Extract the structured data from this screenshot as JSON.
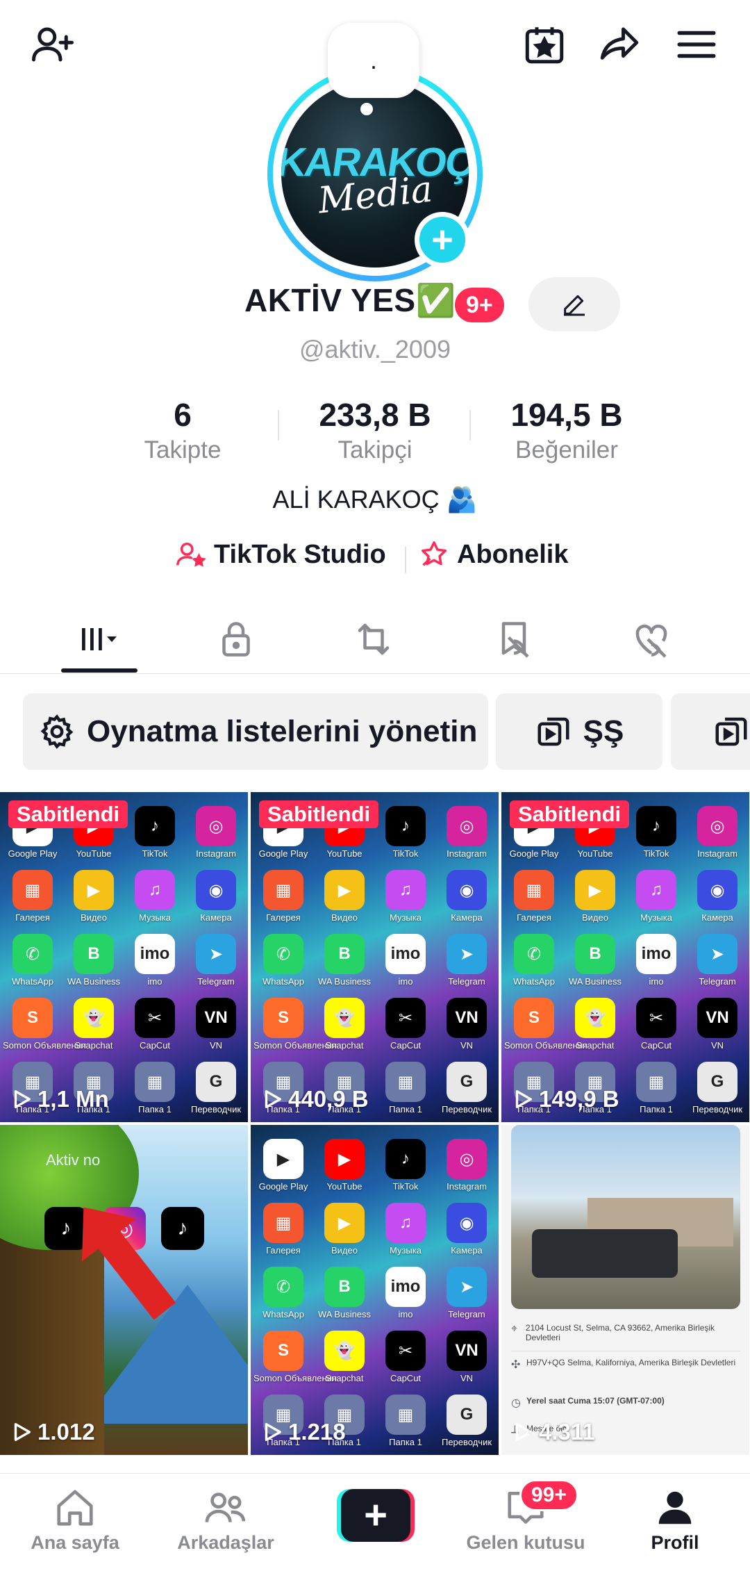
{
  "topbar": {
    "add_friend_icon": "person-plus-icon",
    "calendar_icon": "calendar-star-icon",
    "share_icon": "share-arrow-icon",
    "menu_icon": "hamburger-menu-icon"
  },
  "profile": {
    "note_text": ".",
    "avatar_logo_line1": "KARAKOÇ",
    "avatar_logo_line2": "Media",
    "display_name": "AKTİV YES✅",
    "notification_badge": "9+",
    "username": "@aktiv._2009",
    "bio": "ALİ KARAKOÇ 🫂"
  },
  "stats": [
    {
      "value": "6",
      "label": "Takipte"
    },
    {
      "value": "233,8 B",
      "label": "Takipçi"
    },
    {
      "value": "194,5 B",
      "label": "Beğeniler"
    }
  ],
  "links": {
    "studio": "TikTok Studio",
    "subscription": "Abonelik"
  },
  "tabs": [
    "videos-tab",
    "private-tab",
    "reposts-tab",
    "favorites-tab",
    "liked-tab"
  ],
  "chips": {
    "manage_playlists": "Oynatma listelerini yönetin",
    "playlist_1": "ŞŞ"
  },
  "videos": [
    {
      "pinned": "Sabitlendi",
      "views": "1,1 Mn"
    },
    {
      "pinned": "Sabitlendi",
      "views": "440,9 B"
    },
    {
      "pinned": "Sabitlendi",
      "views": "149,9 B"
    },
    {
      "views": "1.012",
      "overlay_text": "Aktiv no"
    },
    {
      "views": "1.218"
    },
    {
      "views": "4.311"
    }
  ],
  "app_grid": [
    {
      "label": "Google Play",
      "color": "#ffffff",
      "glyph": "▶"
    },
    {
      "label": "YouTube",
      "color": "#ff0000",
      "glyph": "▶"
    },
    {
      "label": "TikTok",
      "color": "#000000",
      "glyph": "♪"
    },
    {
      "label": "Instagram",
      "color": "#d6249f",
      "glyph": "◎"
    },
    {
      "label": "Галерея",
      "color": "#f4562f",
      "glyph": "▦"
    },
    {
      "label": "Видео",
      "color": "#f5c116",
      "glyph": "▶"
    },
    {
      "label": "Музыка",
      "color": "#c44cf0",
      "glyph": "♫"
    },
    {
      "label": "Камера",
      "color": "#3a4de0",
      "glyph": "◉"
    },
    {
      "label": "WhatsApp",
      "color": "#25d366",
      "glyph": "✆"
    },
    {
      "label": "WA Business",
      "color": "#25d366",
      "glyph": "B"
    },
    {
      "label": "imo",
      "color": "#ffffff",
      "glyph": "imo"
    },
    {
      "label": "Telegram",
      "color": "#2aa3e0",
      "glyph": "➤"
    },
    {
      "label": "Somon Объявления",
      "color": "#ff6b2b",
      "glyph": "S"
    },
    {
      "label": "Snapchat",
      "color": "#fffc00",
      "glyph": "👻"
    },
    {
      "label": "CapCut",
      "color": "#000000",
      "glyph": "✂"
    },
    {
      "label": "VN",
      "color": "#000000",
      "glyph": "VN"
    },
    {
      "label": "Папка 1",
      "color": "#6c7aa8",
      "glyph": "▦"
    },
    {
      "label": "Папка 1",
      "color": "#6c7aa8",
      "glyph": "▦"
    },
    {
      "label": "Папка 1",
      "color": "#6c7aa8",
      "glyph": "▦"
    },
    {
      "label": "Переводчик",
      "color": "#e8e8e8",
      "glyph": "G"
    }
  ],
  "map_card": {
    "address_1": "2104 Locust St, Selma, CA 93662, Amerika Birleşik Devletleri",
    "address_2": "H97V+QG Selma, Kaliforniya, Amerika Birleşik Devletleri",
    "local_time": "Yerel saat Cuma 15:07 (GMT-07:00)",
    "distance": "Mesafe ölç"
  },
  "bottom_nav": {
    "home": "Ana sayfa",
    "friends": "Arkadaşlar",
    "inbox": "Gelen kutusu",
    "inbox_badge": "99+",
    "profile": "Profil"
  },
  "colors": {
    "accent_red": "#fe2c55",
    "accent_cyan": "#25f4ee",
    "text_primary": "#161823",
    "text_secondary": "#8a8b91"
  }
}
